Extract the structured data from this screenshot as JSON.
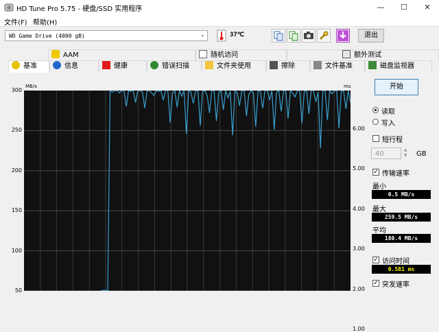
{
  "window": {
    "title": "HD Tune Pro 5.75 - 硬盘/SSD 实用程序",
    "minimize": "—",
    "maximize": "☐",
    "close": "✕"
  },
  "menu": {
    "items": [
      "文件(F)",
      "帮助(H)"
    ]
  },
  "toolbar": {
    "drive_name": "WD      Game Drive (4000 gB)",
    "temperature": "37℃",
    "exit_label": "退出"
  },
  "tabs": {
    "top_row": [
      "AAM",
      "随机访问",
      "额外测试"
    ],
    "bottom_row": [
      "基准",
      "信息",
      "健康",
      "错误扫描",
      "文件夹使用",
      "擦除",
      "文件基准",
      "磁盘监视器"
    ],
    "active": "基准"
  },
  "graph": {
    "left_unit": "MB/s",
    "right_unit": "ms",
    "left_ticks": [
      "300",
      "250",
      "200",
      "150",
      "100",
      "50"
    ],
    "right_ticks": [
      "6.00",
      "5.00",
      "4.00",
      "3.00",
      "2.00",
      "1.00"
    ],
    "line_color": "#3aa0d0",
    "transfer_series": [
      0.5,
      0.5,
      0.5,
      0.5,
      255,
      248,
      252,
      250,
      247,
      253,
      251,
      230,
      255,
      249,
      252,
      235,
      254,
      250,
      248,
      228,
      256,
      251,
      247,
      244,
      253,
      249,
      252,
      238,
      255,
      250,
      210,
      247,
      252,
      229,
      254,
      243,
      250,
      196,
      253,
      248,
      234,
      255,
      251,
      206,
      249,
      253,
      244,
      222,
      257,
      250,
      212,
      248,
      252,
      226,
      254,
      241,
      249,
      194,
      253,
      247,
      231,
      256,
      250,
      218,
      245,
      252,
      247,
      205,
      255,
      249,
      228,
      253,
      250,
      238,
      256,
      201,
      248,
      251,
      224,
      254,
      250,
      215,
      252,
      247,
      242,
      255,
      251,
      209,
      249,
      253,
      221,
      257,
      250,
      236,
      248,
      178,
      252,
      254,
      213,
      250,
      246,
      257,
      251,
      203,
      249,
      255,
      227,
      252,
      235
    ]
  },
  "panel": {
    "start_label": "开始",
    "read_label": "读取",
    "write_label": "写入",
    "short_stroke_label": "短行程",
    "short_stroke_value": "40",
    "short_stroke_unit": "GB",
    "transfer_rate_label": "传输速率",
    "min_label": "最小",
    "min_value": "0.5 MB/s",
    "max_label": "最大",
    "max_value": "259.5 MB/s",
    "avg_label": "平均",
    "avg_value": "180.4 MB/s",
    "access_time_label": "访问时间",
    "access_time_value": "0.581 ms",
    "burst_rate_label": "突发速率"
  }
}
